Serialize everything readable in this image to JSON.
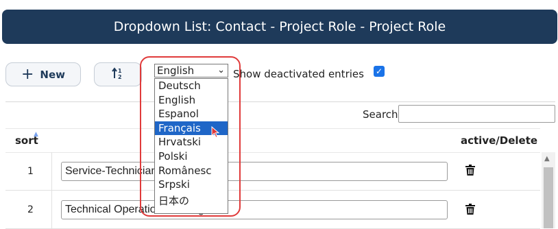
{
  "header": {
    "title": "Dropdown List: Contact - Project Role - Project Role"
  },
  "toolbar": {
    "new_label": "New",
    "sort_icon": "sort-ascending-icon",
    "language_selected": "English",
    "show_deactivated_label": "Show deactivated entries",
    "show_deactivated_checked": true
  },
  "language_options": [
    "Deutsch",
    "English",
    "Espanol",
    "Français",
    "Hrvatski",
    "Polski",
    "Românesc",
    "Srpski",
    "日本の"
  ],
  "language_highlighted": "Français",
  "search": {
    "label": "Search",
    "value": ""
  },
  "table": {
    "headers": {
      "sort": "sort",
      "active_delete": "active/Delete"
    },
    "rows": [
      {
        "sort": "1",
        "value": "Service-Technician"
      },
      {
        "sort": "2",
        "value": "Technical Operations Manager"
      }
    ]
  },
  "colors": {
    "header_bg": "#1e3a5a",
    "accent": "#1a73e8",
    "callout": "#e03a3a",
    "selection": "#1f66c7"
  }
}
